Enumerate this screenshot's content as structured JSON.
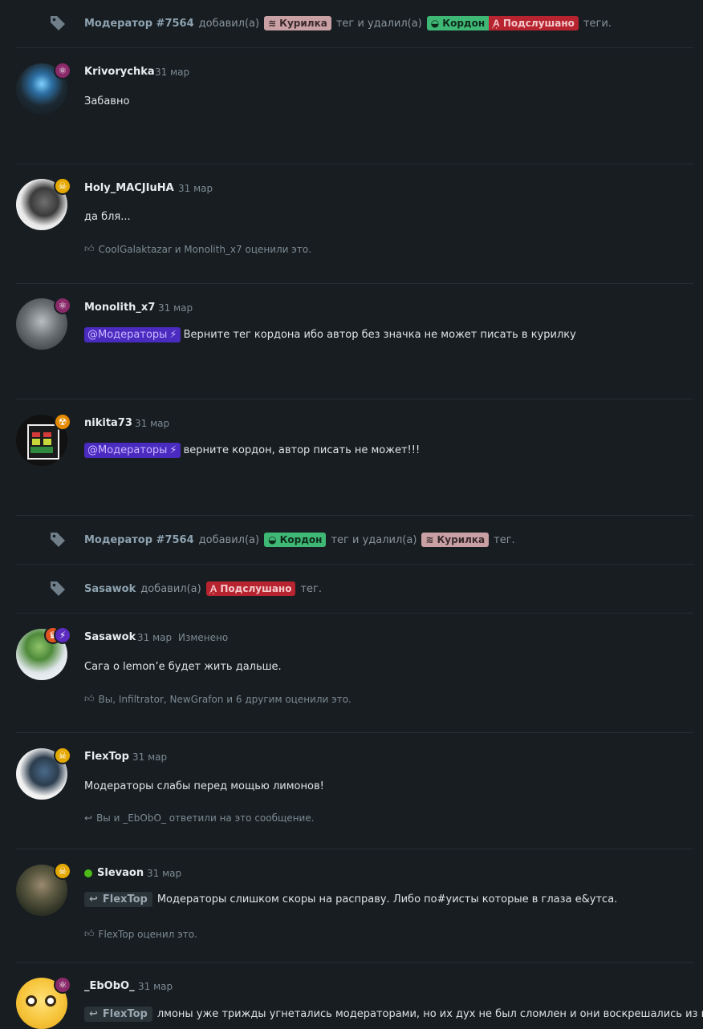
{
  "events": [
    {
      "who": "Модератор #7564",
      "added": "добавил(а)",
      "tag_added_1": "Курилка",
      "middle": "тег и удалил(а)",
      "tag_removed_1": "Кордон",
      "tag_removed_2": "Подслушано",
      "end": "теги."
    },
    {
      "who": "Модератор #7564",
      "added": "добавил(а)",
      "tag_added_1": "Кордон",
      "middle": "тег и удалил(а)",
      "tag_removed_1": "Курилка",
      "end": "тег."
    },
    {
      "who": "Sasawok",
      "added": "добавил(а)",
      "tag_added_1": "Подслушано",
      "end": "тег."
    }
  ],
  "posts": [
    {
      "author": "Krivorychka",
      "date": "31 мар",
      "text": "Забавно"
    },
    {
      "author": "Holy_MACJIuHA",
      "date": "31 мар",
      "text": "да бля...",
      "likes": "CoolGalaktazar и Monolith_x7 оценили это."
    },
    {
      "author": "Monolith_x7",
      "date": "31 мар",
      "mention": "@Модераторы",
      "text": "Верните тег кордона ибо автор без значка не может писать в курилку"
    },
    {
      "author": "nikita73",
      "date": "31 мар",
      "mention": "@Модераторы",
      "text": "верните кордон, автор писать не может!!!"
    },
    {
      "author": "Sasawok",
      "date": "31 мар",
      "edited": "Изменено",
      "text": "Сага о lemon’e будет жить дальше.",
      "likes": "Вы, Infiltrator, NewGrafon и 6 другим оценили это."
    },
    {
      "author": "FlexTop",
      "date": "31 мар",
      "text": "Модераторы слабы перед мощью лимонов!",
      "replies": "Вы и _EbObO_ ответили на это сообщение."
    },
    {
      "author": "Slevaon",
      "date": "31 мар",
      "reply_to": "FlexTop",
      "text": "Модераторы слишком скоры на расправу. Либо по#уисты которые в глаза е&утса.",
      "likes": "FlexTop оценил это."
    },
    {
      "author": "_EbObO_",
      "date": "31 мар",
      "reply_to": "FlexTop",
      "text": "лмоны уже трижды угнетались модераторами, но их дух не был сломлен и они воскрешались из пепла"
    }
  ],
  "colors": {
    "background": "#171d21",
    "kurilka": "#c9a0a4",
    "kordon": "#3fb876",
    "podslushano": "#b7242f",
    "mention": "#4a2bbf",
    "online": "#4cbb17"
  }
}
